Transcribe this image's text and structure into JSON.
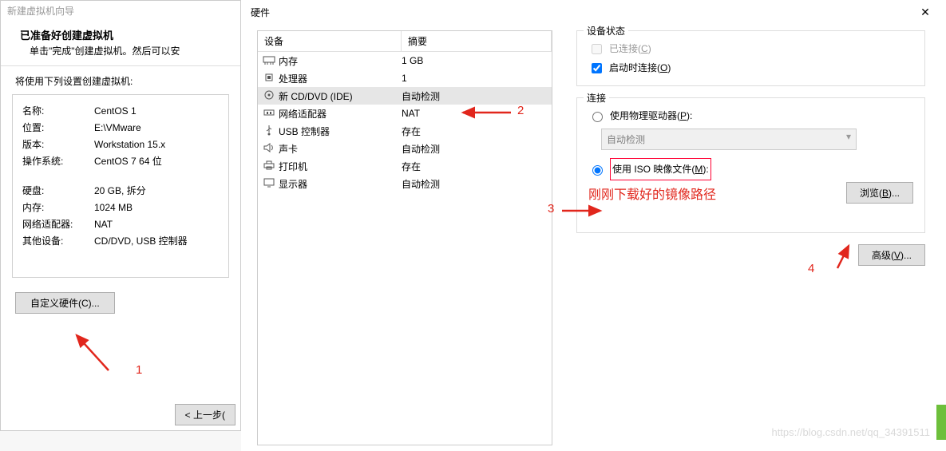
{
  "wizard": {
    "window_title": "新建虚拟机向导",
    "heading": "已准备好创建虚拟机",
    "subtitle": "单击\"完成\"创建虚拟机。然后可以安",
    "use_label": "将使用下列设置创建虚拟机:",
    "rows": [
      {
        "k": "名称:",
        "v": "CentOS 1"
      },
      {
        "k": "位置:",
        "v": "E:\\VMware"
      },
      {
        "k": "版本:",
        "v": "Workstation 15.x"
      },
      {
        "k": "操作系统:",
        "v": "CentOS 7 64 位"
      }
    ],
    "rows2": [
      {
        "k": "硬盘:",
        "v": "20 GB, 拆分"
      },
      {
        "k": "内存:",
        "v": "1024 MB"
      },
      {
        "k": "网络适配器:",
        "v": "NAT"
      },
      {
        "k": "其他设备:",
        "v": "CD/DVD, USB 控制器"
      }
    ],
    "custom_btn": "自定义硬件(C)...",
    "back_btn": "< 上一步("
  },
  "hardware": {
    "title": "硬件",
    "columns": {
      "device": "设备",
      "summary": "摘要"
    },
    "devices": [
      {
        "name": "内存",
        "summary": "1 GB",
        "icon": "memory"
      },
      {
        "name": "处理器",
        "summary": "1",
        "icon": "cpu"
      },
      {
        "name": "新 CD/DVD (IDE)",
        "summary": "自动检测",
        "icon": "disc",
        "selected": true
      },
      {
        "name": "网络适配器",
        "summary": "NAT",
        "icon": "net"
      },
      {
        "name": "USB 控制器",
        "summary": "存在",
        "icon": "usb"
      },
      {
        "name": "声卡",
        "summary": "自动检测",
        "icon": "sound"
      },
      {
        "name": "打印机",
        "summary": "存在",
        "icon": "printer"
      },
      {
        "name": "显示器",
        "summary": "自动检测",
        "icon": "monitor"
      }
    ],
    "status": {
      "legend": "设备状态",
      "connected_label": "已连接",
      "connected_key": "C",
      "startup_label": "启动时连接",
      "startup_key": "O"
    },
    "conn": {
      "legend": "连接",
      "phys_label": "使用物理驱动器",
      "phys_key": "P",
      "phys_select": "自动检测",
      "iso_label": "使用 ISO 映像文件",
      "iso_key": "M",
      "browse_label": "浏览",
      "browse_key": "B",
      "adv_label": "高级",
      "adv_key": "V"
    }
  },
  "annotations": {
    "n1": "1",
    "n2": "2",
    "n3": "3",
    "n4": "4",
    "red_note": "刚刚下载好的镜像路径"
  },
  "watermark": "https://blog.csdn.net/qq_34391511"
}
